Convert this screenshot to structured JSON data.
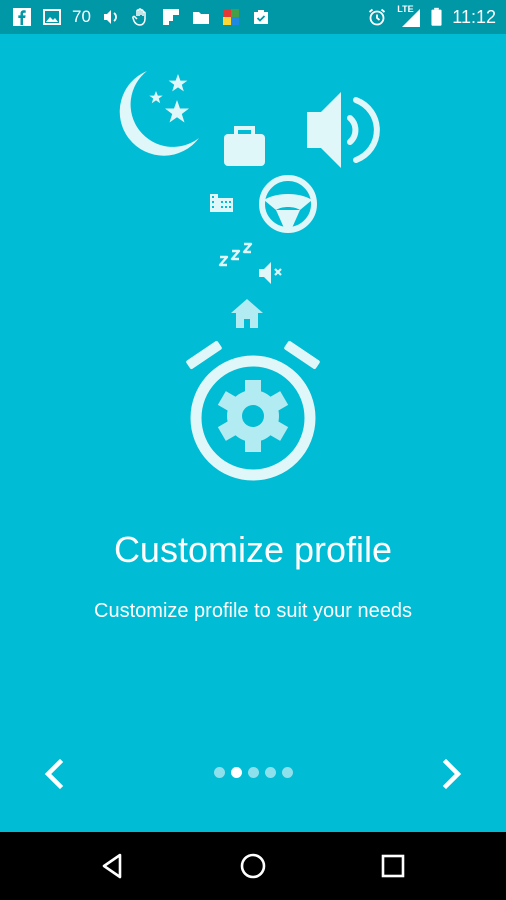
{
  "status_bar": {
    "notification_count": "70",
    "network": "LTE",
    "time": "11:12",
    "icons": [
      "facebook-icon",
      "image-icon",
      "volume-icon",
      "hand-icon",
      "flipboard-icon",
      "folder-icon",
      "app-icon",
      "briefcase-check-icon",
      "alarm-icon",
      "signal-icon",
      "battery-icon"
    ]
  },
  "onboarding": {
    "title": "Customize profile",
    "subtitle": "Customize profile to suit your needs",
    "page_count": 5,
    "active_page": 2,
    "prev_icon": "chevron-left-icon",
    "next_icon": "chevron-right-icon"
  },
  "nav_bar": {
    "icons": [
      "back-icon",
      "home-icon",
      "recents-icon"
    ]
  },
  "colors": {
    "background": "#00BCD4",
    "status_bar": "#0097A7",
    "nav_bar": "#000000",
    "accent_light": "#B2EBF2"
  }
}
